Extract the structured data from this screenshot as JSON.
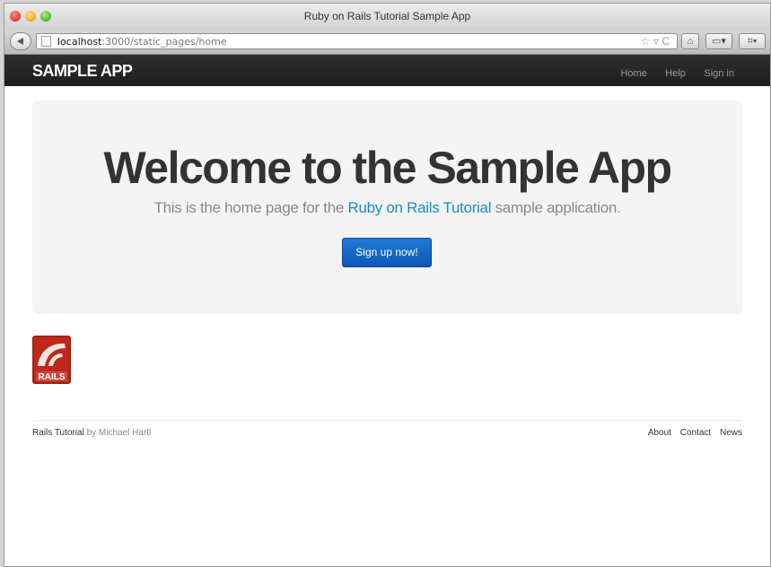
{
  "window": {
    "title": "Ruby on Rails Tutorial Sample App"
  },
  "address_bar": {
    "host": "localhost",
    "path": ":3000/static_pages/home",
    "icons": "☆ ▿ C"
  },
  "toolbar": {
    "home_icon": "⌂",
    "window_icon": "▭▾",
    "extra_icon": "⌗▾"
  },
  "navbar": {
    "brand": "SAMPLE APP",
    "links": [
      "Home",
      "Help",
      "Sign in"
    ]
  },
  "hero": {
    "heading": "Welcome to the Sample App",
    "text_before": "This is the home page for the ",
    "link_text": "Ruby on Rails Tutorial",
    "text_after": " sample application.",
    "button": "Sign up now!"
  },
  "logo": {
    "text": "RAILS"
  },
  "footer": {
    "left_title": "Rails Tutorial",
    "left_by": " by Michael Hartl",
    "links": [
      "About",
      "Contact",
      "News"
    ]
  },
  "colors": {
    "navbar": "#222222",
    "hero_bg": "#f4f4f4",
    "link": "#1a8ac7",
    "button": "#0e56b8",
    "rails_red": "#c0281b"
  }
}
